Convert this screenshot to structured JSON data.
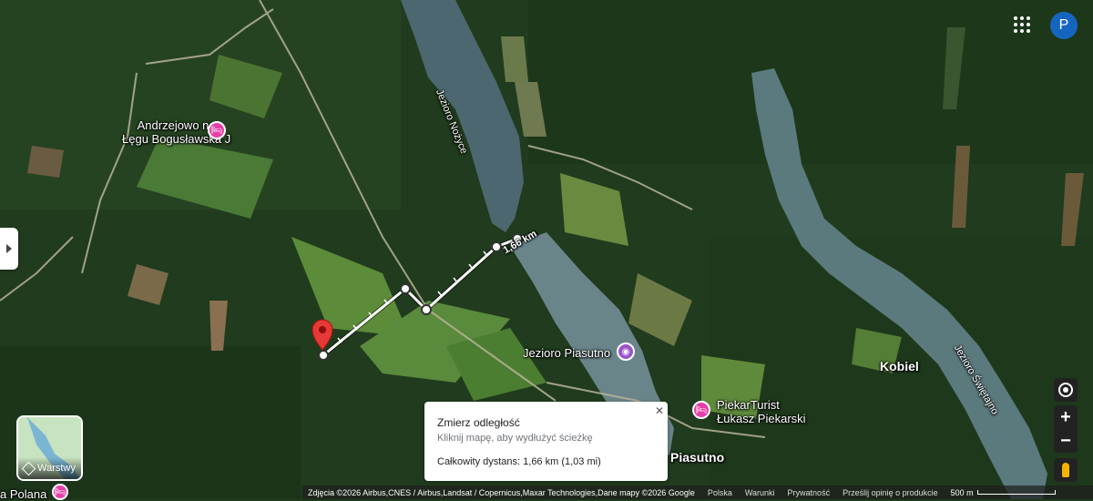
{
  "map": {
    "labels": {
      "andrzejowo": [
        "Andrzejowo na",
        "Łęgu Bogusławska J"
      ],
      "lake_nozyce": "Jezioro Nożyce",
      "lake_piasutno": "Jezioro Piasutno",
      "piekar": [
        "PiekarTurist",
        "Łukasz Piekarski"
      ],
      "piasutno": "Piasutno",
      "kobiel": "Kobiel",
      "lake_swietajno": "Jezioro Świętajno",
      "polana": "a Polana"
    },
    "measure_label": "1,66 km"
  },
  "header": {
    "avatar_letter": "P"
  },
  "controls": {
    "zoom_in": "+",
    "zoom_out": "−"
  },
  "layers": {
    "label": "Warstwy"
  },
  "measure_card": {
    "title": "Zmierz odległość",
    "hint": "Kliknij mapę, aby wydłużyć ścieżkę",
    "total": "Całkowity dystans: 1,66 km (1,03 mi)",
    "close": "✕"
  },
  "footer": {
    "attribution": "Zdjęcia ©2026 Airbus,CNES / Airbus,Landsat / Copernicus,Maxar Technologies,Dane mapy ©2026 Google",
    "country": "Polska",
    "terms": "Warunki",
    "privacy": "Prywatność",
    "feedback": "Prześlij opinię o produkcie",
    "scale": "500 m"
  },
  "colors": {
    "pin": "#e53935",
    "poi_pink": "#e63fa9",
    "poi_purple": "#9a55c9",
    "avatar": "#1565c0"
  }
}
